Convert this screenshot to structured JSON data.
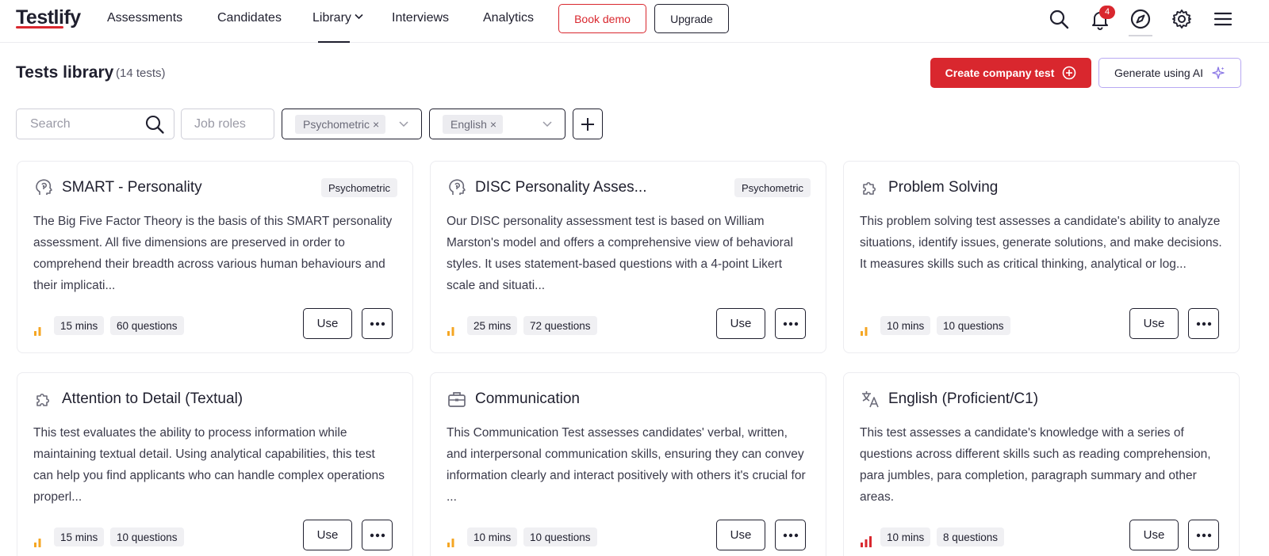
{
  "brand": {
    "name": "Testlify",
    "accent": "#d9272e"
  },
  "nav": {
    "items": [
      "Assessments",
      "Candidates",
      "Library",
      "Interviews",
      "Analytics"
    ],
    "book_demo": "Book demo",
    "upgrade": "Upgrade",
    "notifications_count": "4",
    "icons": [
      "search-icon",
      "bell-icon",
      "compass-icon",
      "gear-icon",
      "menu-icon"
    ]
  },
  "header": {
    "title": "Tests library",
    "count": "(14 tests)",
    "create_button": "Create company test",
    "ai_button": "Generate using AI"
  },
  "filters": {
    "search_placeholder": "Search",
    "job_roles_placeholder": "Job roles",
    "type_chip": "Psychometric",
    "language_chip": "English"
  },
  "cards": [
    {
      "title": "SMART - Personality",
      "tag": "Psychometric",
      "icon": "brain-head-icon",
      "description": "The Big Five Factor Theory is the basis of this SMART personality assessment. All five dimensions are preserved in order to comprehend their breadth across various human behaviours and their implicati...",
      "duration": "15 mins",
      "questions": "60 questions",
      "level": 1,
      "use_label": "Use"
    },
    {
      "title": "DISC Personality Asses...",
      "tag": "Psychometric",
      "icon": "brain-head-icon",
      "description": "Our DISC personality assessment test is based on William Marston's model and offers a comprehensive view of behavioral styles. It uses statement-based questions with a 4-point Likert scale and situati...",
      "duration": "25 mins",
      "questions": "72 questions",
      "level": 1,
      "use_label": "Use"
    },
    {
      "title": "Problem Solving",
      "tag": "",
      "icon": "puzzle-icon",
      "description": "This problem solving test assesses a candidate's ability to analyze situations, identify issues, generate solutions, and make decisions. It measures skills such as critical thinking, analytical or log...",
      "duration": "10 mins",
      "questions": "10 questions",
      "level": 1,
      "use_label": "Use"
    },
    {
      "title": "Attention to Detail (Textual)",
      "tag": "",
      "icon": "puzzle-icon",
      "description": "This test evaluates the ability to process information while maintaining textual detail. Using analytical capabilities, this test can help you find applicants who can handle complex operations properl...",
      "duration": "15 mins",
      "questions": "10 questions",
      "level": 1,
      "use_label": "Use"
    },
    {
      "title": "Communication",
      "tag": "",
      "icon": "briefcase-icon",
      "description": "This Communication Test assesses candidates' verbal, written, and interpersonal communication skills, ensuring they can convey information clearly and interact positively with others it's crucial for ...",
      "duration": "10 mins",
      "questions": "10 questions",
      "level": 1,
      "use_label": "Use"
    },
    {
      "title": "English (Proficient/C1)",
      "tag": "",
      "icon": "translate-icon",
      "description": "This test assesses a candidate's knowledge with a series of questions across different skills such as reading comprehension, para jumbles, para completion, paragraph summary and other areas.",
      "duration": "10 mins",
      "questions": "8 questions",
      "level": 3,
      "use_label": "Use"
    }
  ]
}
